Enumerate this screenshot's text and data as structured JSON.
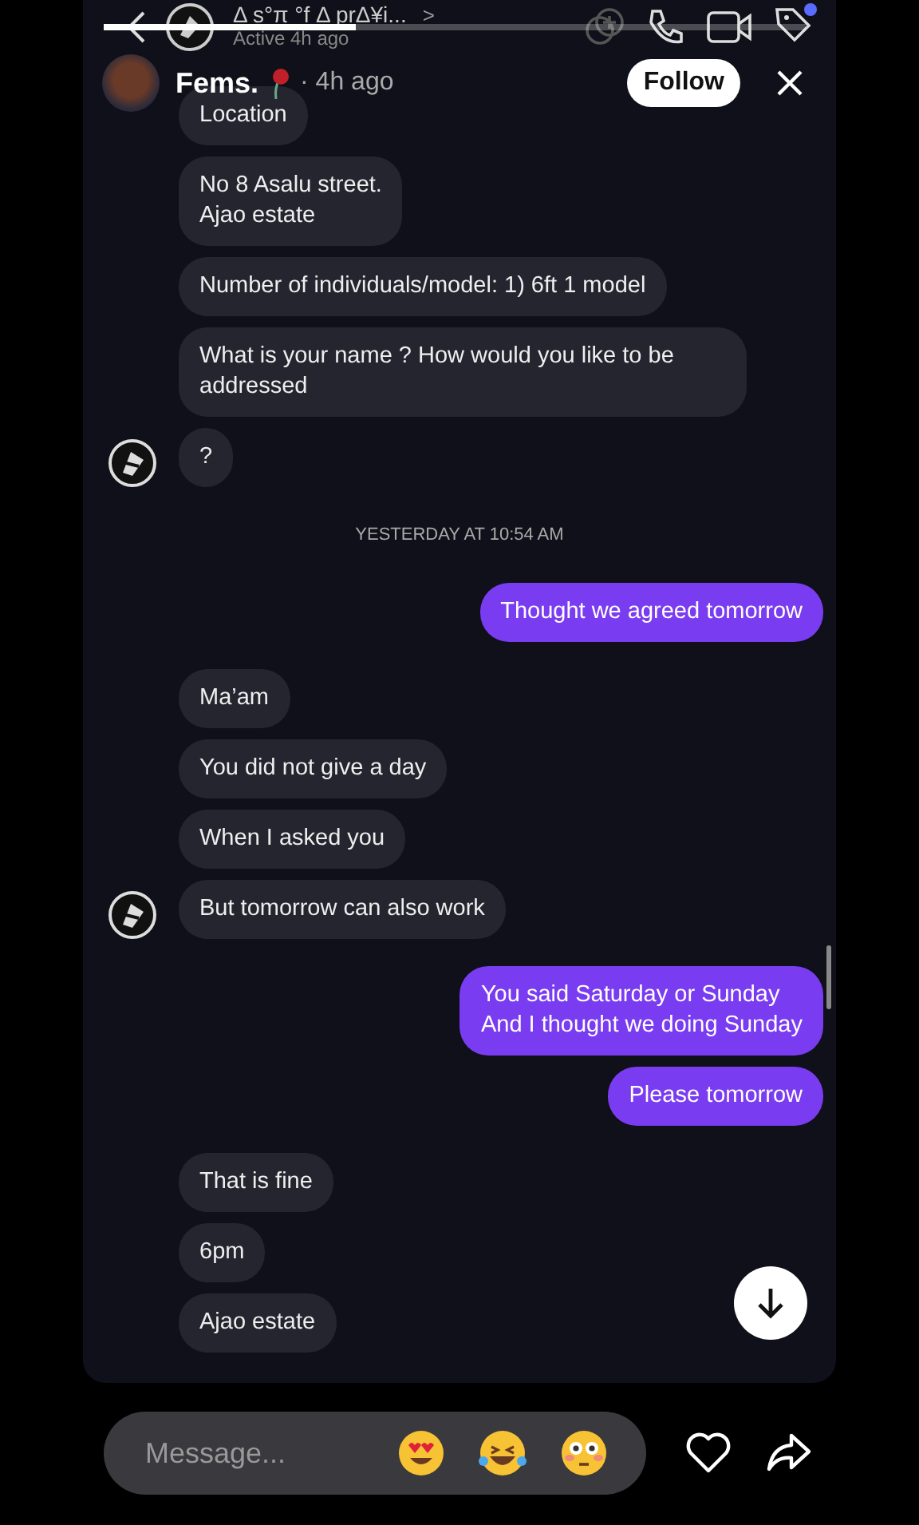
{
  "top_bar": {
    "title": "Δ s°π °f Δ prΔ¥i...",
    "chevron": ">",
    "status": "Active 4h ago",
    "notification_dot": true
  },
  "video_progress": {
    "level": 0.36
  },
  "post_header": {
    "name": "Fems.",
    "time": "· 4h ago",
    "follow": "Follow"
  },
  "messages": [
    {
      "kind": "received",
      "lines": [
        "Location"
      ],
      "avatar": false
    },
    {
      "kind": "received",
      "lines": [
        "No 8 Asalu street.",
        "Ajao estate"
      ],
      "avatar": false
    },
    {
      "kind": "received",
      "lines": [
        "Number of individuals/model: 1) 6ft 1 model"
      ],
      "avatar": false
    },
    {
      "kind": "received",
      "lines": [
        "What is your name ? How would you like to be addressed"
      ],
      "avatar": false
    },
    {
      "kind": "received",
      "lines": [
        "?"
      ],
      "avatar": true
    },
    {
      "kind": "timestamp",
      "lines": [
        "YESTERDAY AT 10:54 AM"
      ]
    },
    {
      "kind": "sent",
      "lines": [
        "Thought we agreed tomorrow"
      ]
    },
    {
      "kind": "received",
      "lines": [
        "Ma’am"
      ],
      "avatar": false
    },
    {
      "kind": "received",
      "lines": [
        "You did not give a day"
      ],
      "avatar": false
    },
    {
      "kind": "received",
      "lines": [
        "When I asked you"
      ],
      "avatar": false
    },
    {
      "kind": "received",
      "lines": [
        "But tomorrow can also work"
      ],
      "avatar": true
    },
    {
      "kind": "sent",
      "lines": [
        "You said Saturday or Sunday",
        "And I thought we doing Sunday"
      ]
    },
    {
      "kind": "sent",
      "lines": [
        "Please tomorrow"
      ]
    },
    {
      "kind": "received",
      "lines": [
        "That is fine"
      ],
      "avatar": false
    },
    {
      "kind": "received",
      "lines": [
        "6pm"
      ],
      "avatar": false
    },
    {
      "kind": "received",
      "lines": [
        "Ajao estate"
      ],
      "avatar": false
    }
  ],
  "composer": {
    "placeholder": "Message..."
  }
}
